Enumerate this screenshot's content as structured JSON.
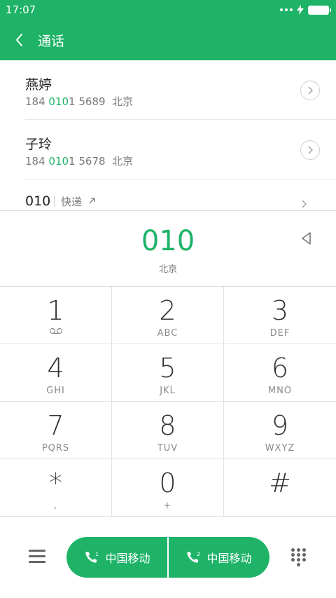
{
  "status_bar": {
    "time": "17:07"
  },
  "header": {
    "title": "通话"
  },
  "results": [
    {
      "name": "燕婷",
      "number_prefix": "184 ",
      "number_match": "010",
      "number_suffix": "1 5689",
      "location": "北京"
    },
    {
      "name": "子玲",
      "number_prefix": "184 ",
      "number_match": "010",
      "number_suffix": "1 5678",
      "location": "北京"
    }
  ],
  "partial_row": {
    "keyword": "010",
    "tag": "快递"
  },
  "dial": {
    "number": "010",
    "location": "北京"
  },
  "keypad": [
    {
      "digit": "1",
      "letters": ""
    },
    {
      "digit": "2",
      "letters": "ABC"
    },
    {
      "digit": "3",
      "letters": "DEF"
    },
    {
      "digit": "4",
      "letters": "GHI"
    },
    {
      "digit": "5",
      "letters": "JKL"
    },
    {
      "digit": "6",
      "letters": "MNO"
    },
    {
      "digit": "7",
      "letters": "PQRS"
    },
    {
      "digit": "8",
      "letters": "TUV"
    },
    {
      "digit": "9",
      "letters": "WXYZ"
    },
    {
      "digit": "*",
      "letters": ","
    },
    {
      "digit": "0",
      "letters": "+"
    },
    {
      "digit": "#",
      "letters": ""
    }
  ],
  "call_buttons": [
    {
      "sim": "1",
      "label": "中国移动"
    },
    {
      "sim": "2",
      "label": "中国移动"
    }
  ],
  "colors": {
    "accent": "#1fb368",
    "text": "#222222",
    "secondary": "#7a7a7a"
  }
}
